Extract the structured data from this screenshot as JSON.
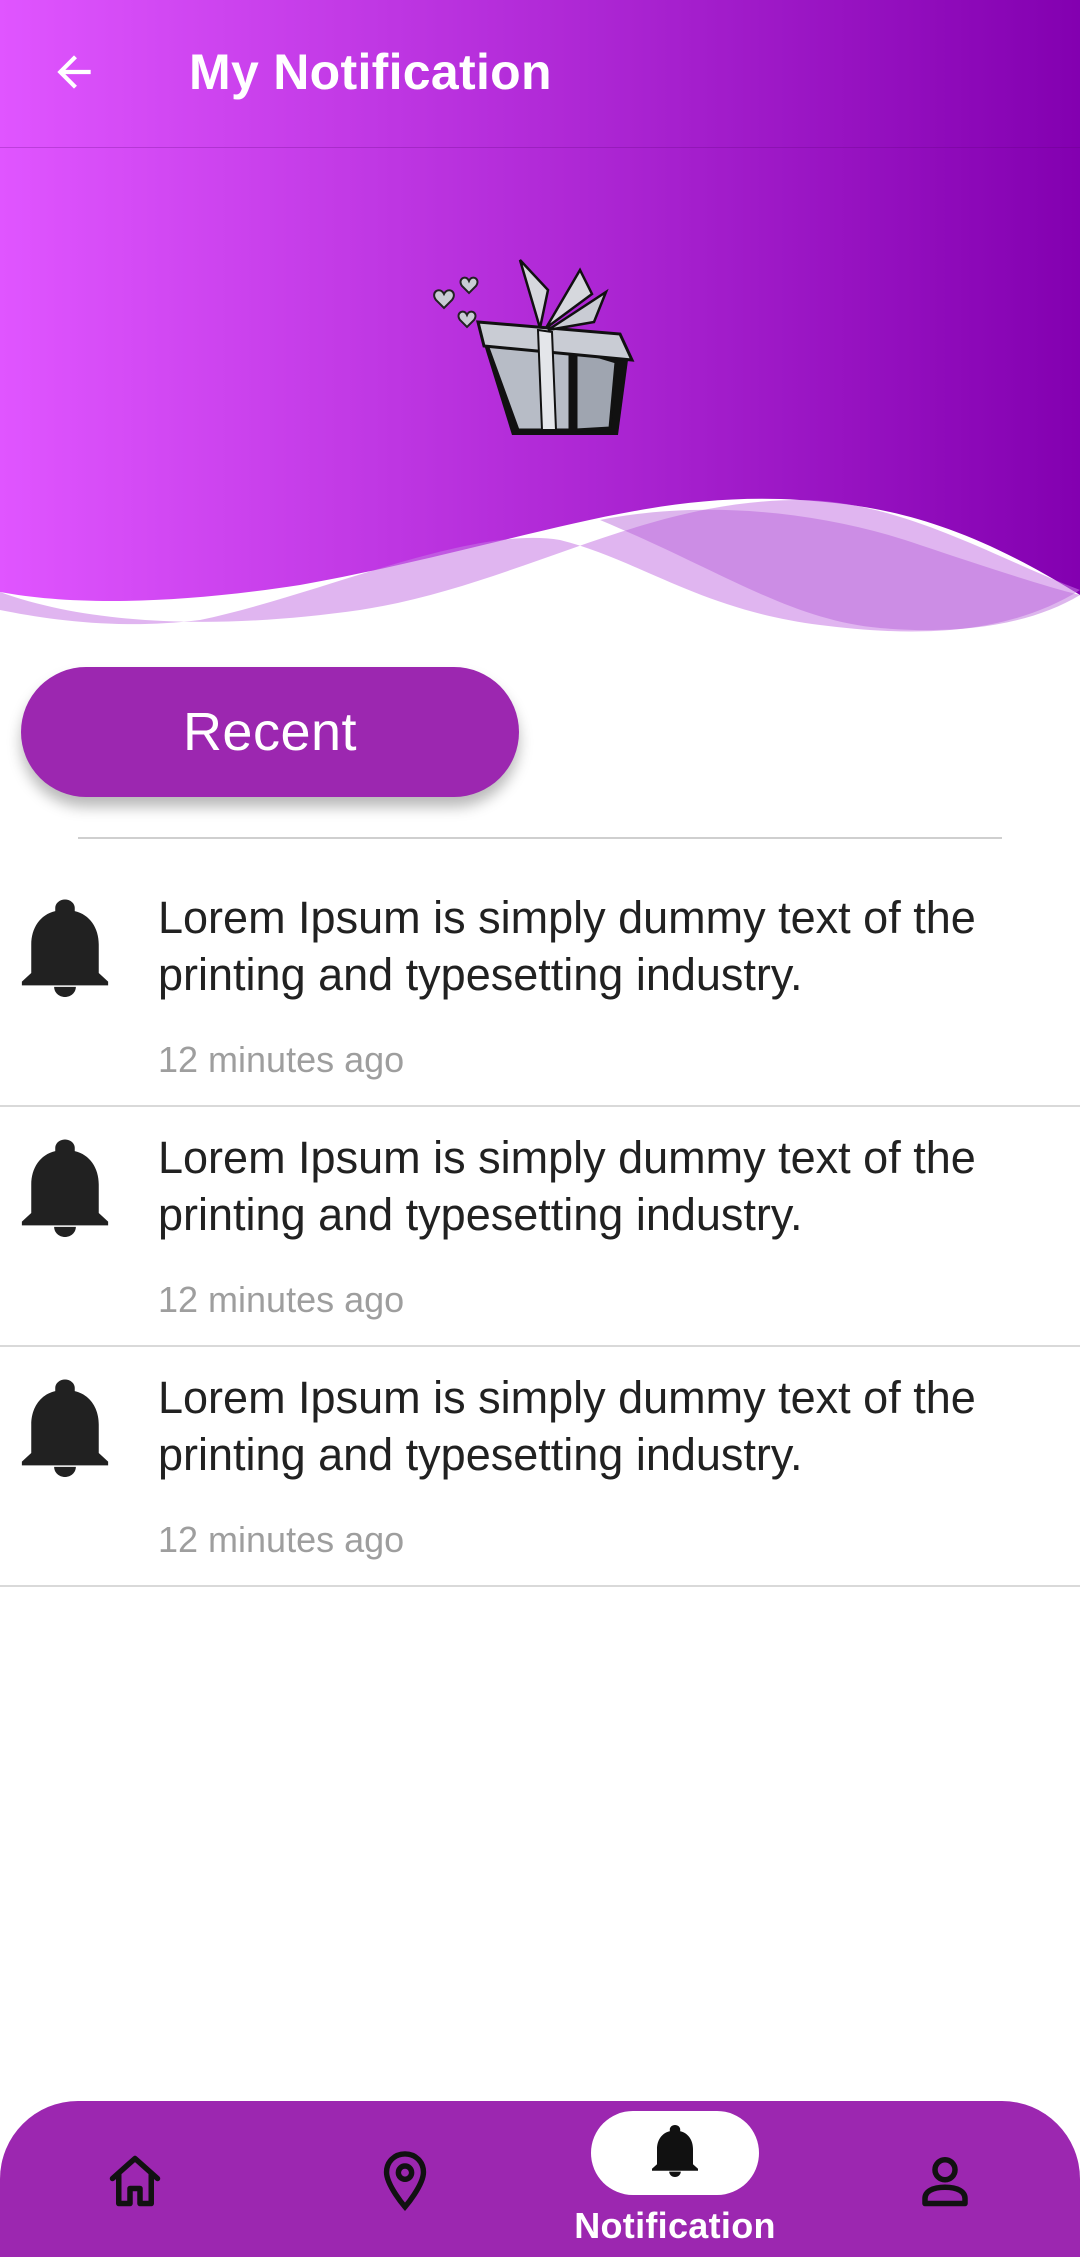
{
  "header": {
    "title": "My Notification",
    "back_icon": "arrow-left-icon",
    "gradient_start": "#e055ff",
    "gradient_end": "#8300b0"
  },
  "filter": {
    "recent_label": "Recent"
  },
  "notifications": [
    {
      "icon": "bell-icon",
      "text": "Lorem Ipsum is simply dummy text of the printing and typesetting industry.",
      "time": "12 minutes ago"
    },
    {
      "icon": "bell-icon",
      "text": "Lorem Ipsum is simply dummy text of the printing and typesetting industry.",
      "time": "12 minutes ago"
    },
    {
      "icon": "bell-icon",
      "text": "Lorem Ipsum is simply dummy text of the printing and typesetting industry.",
      "time": "12 minutes ago"
    }
  ],
  "bottom_nav": {
    "items": [
      {
        "icon": "home-icon"
      },
      {
        "icon": "location-pin-icon"
      },
      {
        "icon": "bell-icon",
        "label": "Notification",
        "active": true
      },
      {
        "icon": "profile-icon"
      }
    ],
    "background": "#9c27b0"
  },
  "colors": {
    "accent": "#9c27b0",
    "text": "#212121",
    "muted": "#9e9e9e"
  }
}
